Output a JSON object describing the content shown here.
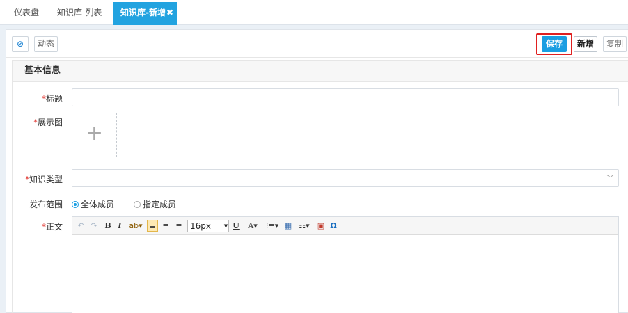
{
  "tabs": [
    {
      "label": "仪表盘"
    },
    {
      "label": "知识库-列表"
    },
    {
      "label": "知识库-新增"
    }
  ],
  "toolbar": {
    "dynamic_label": "动态",
    "save_label": "保存",
    "add_label": "新增",
    "copy_label": "复制"
  },
  "section": {
    "title": "基本信息"
  },
  "form": {
    "title_label": "标题",
    "image_label": "展示图",
    "type_label": "知识类型",
    "scope_label": "发布范围",
    "scope_options": [
      "全体成员",
      "指定成员"
    ],
    "scope_selected": "全体成员",
    "body_label": "正文",
    "required_mark": "*",
    "upload_plus": "+"
  },
  "editor": {
    "font_size": "16px",
    "tools": [
      "undo-icon",
      "redo-icon",
      "bold-icon",
      "italic-icon",
      "highlight-icon",
      "align-left-icon",
      "align-center-icon",
      "align-right-icon",
      "font-size-select",
      "underline-icon",
      "font-color-icon",
      "ordered-list-icon",
      "table-icon",
      "unordered-list-icon",
      "image-icon",
      "special-char-icon"
    ]
  },
  "colors": {
    "accent": "#1a9ee2",
    "tab_active": "#22a3e0",
    "required": "#e0302a",
    "highlight_border": "#e02020"
  }
}
